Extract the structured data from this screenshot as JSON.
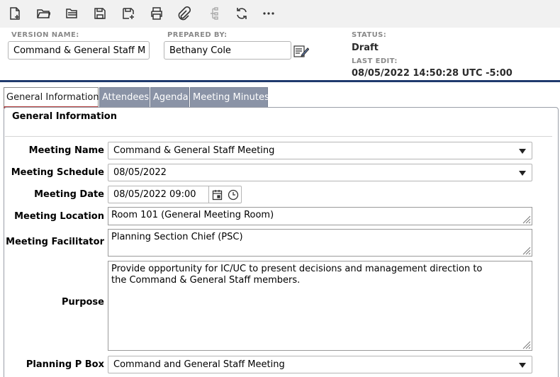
{
  "toolbar": {
    "buttons": [
      {
        "name": "new-document-icon"
      },
      {
        "name": "open-folder-icon"
      },
      {
        "name": "open-multiple-icon"
      },
      {
        "name": "save-icon"
      },
      {
        "name": "save-as-icon"
      },
      {
        "name": "print-icon"
      },
      {
        "name": "attachment-icon"
      },
      {
        "name": "hierarchy-icon"
      },
      {
        "name": "refresh-icon"
      },
      {
        "name": "more-icon"
      }
    ]
  },
  "header": {
    "version_label": "VERSION NAME:",
    "version_value": "Command & General Staff M ...",
    "prepared_label": "PREPARED BY:",
    "prepared_value": "Bethany Cole",
    "status_label": "STATUS:",
    "status_value": "Draft",
    "last_edit_label": "LAST EDIT:",
    "last_edit_value": "08/05/2022 14:50:28 UTC -5:00"
  },
  "tabs": [
    {
      "label": "General Information",
      "active": true
    },
    {
      "label": "Attendees",
      "active": false
    },
    {
      "label": "Agenda",
      "active": false
    },
    {
      "label": "Meeting Minutes",
      "active": false
    }
  ],
  "section": {
    "title": "General Information"
  },
  "form": {
    "meeting_name": {
      "label": "Meeting Name",
      "value": "Command & General Staff Meeting"
    },
    "meeting_schedule": {
      "label": "Meeting Schedule",
      "value": "08/05/2022"
    },
    "meeting_date": {
      "label": "Meeting Date",
      "value": "08/05/2022 09:00"
    },
    "meeting_location": {
      "label": "Meeting Location",
      "value": "Room 101 (General Meeting Room)"
    },
    "meeting_facilitator": {
      "label": "Meeting Facilitator",
      "value": "Planning Section Chief (PSC)"
    },
    "purpose": {
      "label": "Purpose",
      "value": "Provide opportunity for IC/UC to present decisions and management direction to the Command & General Staff members."
    },
    "planning_p_box": {
      "label": "Planning P Box",
      "value": "Command and General Staff Meeting"
    }
  },
  "colors": {
    "header_border": "#1f3a6e",
    "tab_inactive": "#8a93a6",
    "tab_active_underline": "#b23a3a"
  }
}
